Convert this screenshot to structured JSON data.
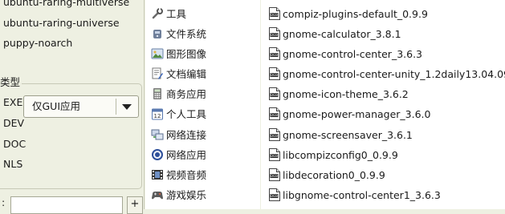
{
  "repos": [
    {
      "label": "ubuntu-raring-multiverse"
    },
    {
      "label": "ubuntu-raring-universe"
    },
    {
      "label": "puppy-noarch"
    }
  ],
  "type_section": {
    "title": "类型",
    "items": [
      "EXE",
      "DEV",
      "DOC",
      "NLS"
    ],
    "combo_value": "仅GUI应用"
  },
  "bottom": {
    "colon": ":",
    "button_label": "+"
  },
  "categories": [
    {
      "label": "工具",
      "icon": "tools-icon"
    },
    {
      "label": "文件系统",
      "icon": "filesystem-icon"
    },
    {
      "label": "图形图像",
      "icon": "graphics-icon"
    },
    {
      "label": "文档编辑",
      "icon": "document-icon"
    },
    {
      "label": "商务应用",
      "icon": "calculator-icon"
    },
    {
      "label": "个人工具",
      "icon": "calendar-icon"
    },
    {
      "label": "网络连接",
      "icon": "network-icon"
    },
    {
      "label": "网络应用",
      "icon": "internet-icon"
    },
    {
      "label": "视频音频",
      "icon": "multimedia-icon"
    },
    {
      "label": "游戏娱乐",
      "icon": "games-icon"
    }
  ],
  "packages": [
    {
      "label": "compiz-plugins-default_0.9.9"
    },
    {
      "label": "gnome-calculator_3.8.1"
    },
    {
      "label": "gnome-control-center_3.6.3"
    },
    {
      "label": "gnome-control-center-unity_1.2daily13.04.09"
    },
    {
      "label": "gnome-icon-theme_3.6.2"
    },
    {
      "label": "gnome-power-manager_3.6.0"
    },
    {
      "label": "gnome-screensaver_3.6.1"
    },
    {
      "label": "libcompizconfig0_0.9.9"
    },
    {
      "label": "libdecoration0_0.9.9"
    },
    {
      "label": "libgnome-control-center1_3.6.3"
    }
  ],
  "colors": {
    "window_bg": "#eef0e2",
    "list_bg": "#ffffff",
    "border": "#c7c9b6"
  }
}
